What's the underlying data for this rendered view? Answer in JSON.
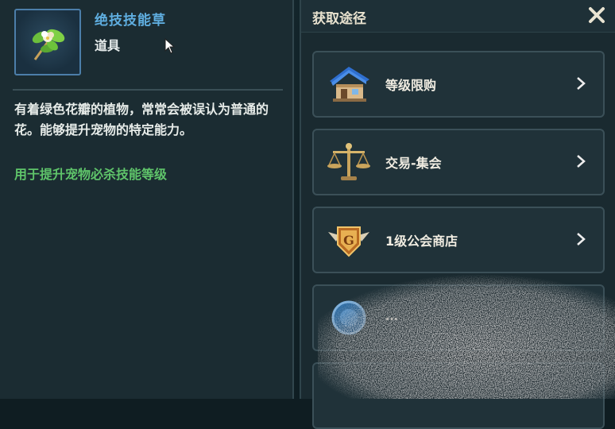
{
  "item": {
    "name": "绝技技能草",
    "type": "道具",
    "description": "有着绿色花瓣的植物，常常会被误认为普通的花。能够提升宠物的特定能力。",
    "effect": "用于提升宠物必杀技能等级",
    "icon": "leaf-flower-icon"
  },
  "sources": {
    "title": "获取途径",
    "close_icon": "close-icon",
    "items": [
      {
        "label": "等级限购",
        "icon": "house-icon"
      },
      {
        "label": "交易-集会",
        "icon": "scales-icon"
      },
      {
        "label": "1级公会商店",
        "icon": "guild-g-badge-icon"
      },
      {
        "label": "…",
        "icon": "blue-orb-icon"
      }
    ]
  },
  "colors": {
    "item_name": "#5faee0",
    "effect": "#5fc46a",
    "text": "#e7ece9"
  }
}
